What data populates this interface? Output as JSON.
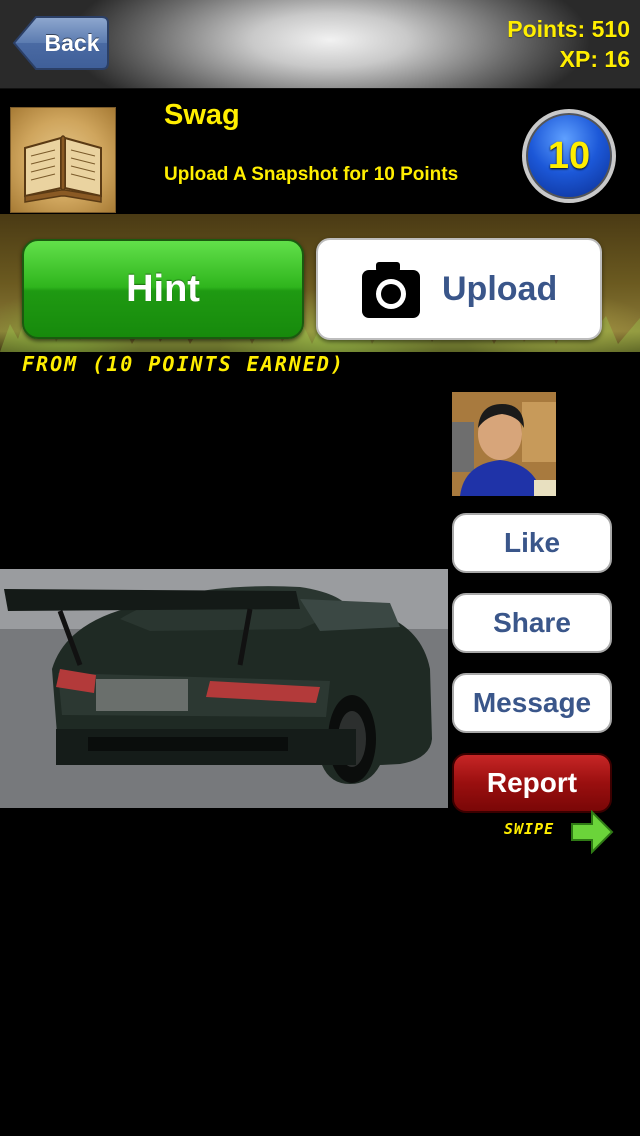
{
  "navbar": {
    "back_label": "Back",
    "points_text": "Points: 510",
    "xp_text": "XP: 16"
  },
  "challenge": {
    "title": "Swag",
    "subtitle": "Upload A Snapshot for 10 Points",
    "points_value": "10",
    "icon": "book-icon"
  },
  "actions": {
    "hint_label": "Hint",
    "upload_label": "Upload",
    "upload_icon": "camera-icon"
  },
  "submission": {
    "from_text": "FROM  (10 POINTS EARNED)"
  },
  "side_actions": {
    "like_label": "Like",
    "share_label": "Share",
    "message_label": "Message",
    "report_label": "Report",
    "swipe_label": "SWIPE",
    "swipe_icon": "arrow-right-icon"
  },
  "colors": {
    "accent_yellow": "#ffee00",
    "hint_green": "#2fb51d",
    "report_red": "#9a0f0f",
    "button_text_blue": "#3a568a",
    "badge_blue": "#1c58d8"
  }
}
